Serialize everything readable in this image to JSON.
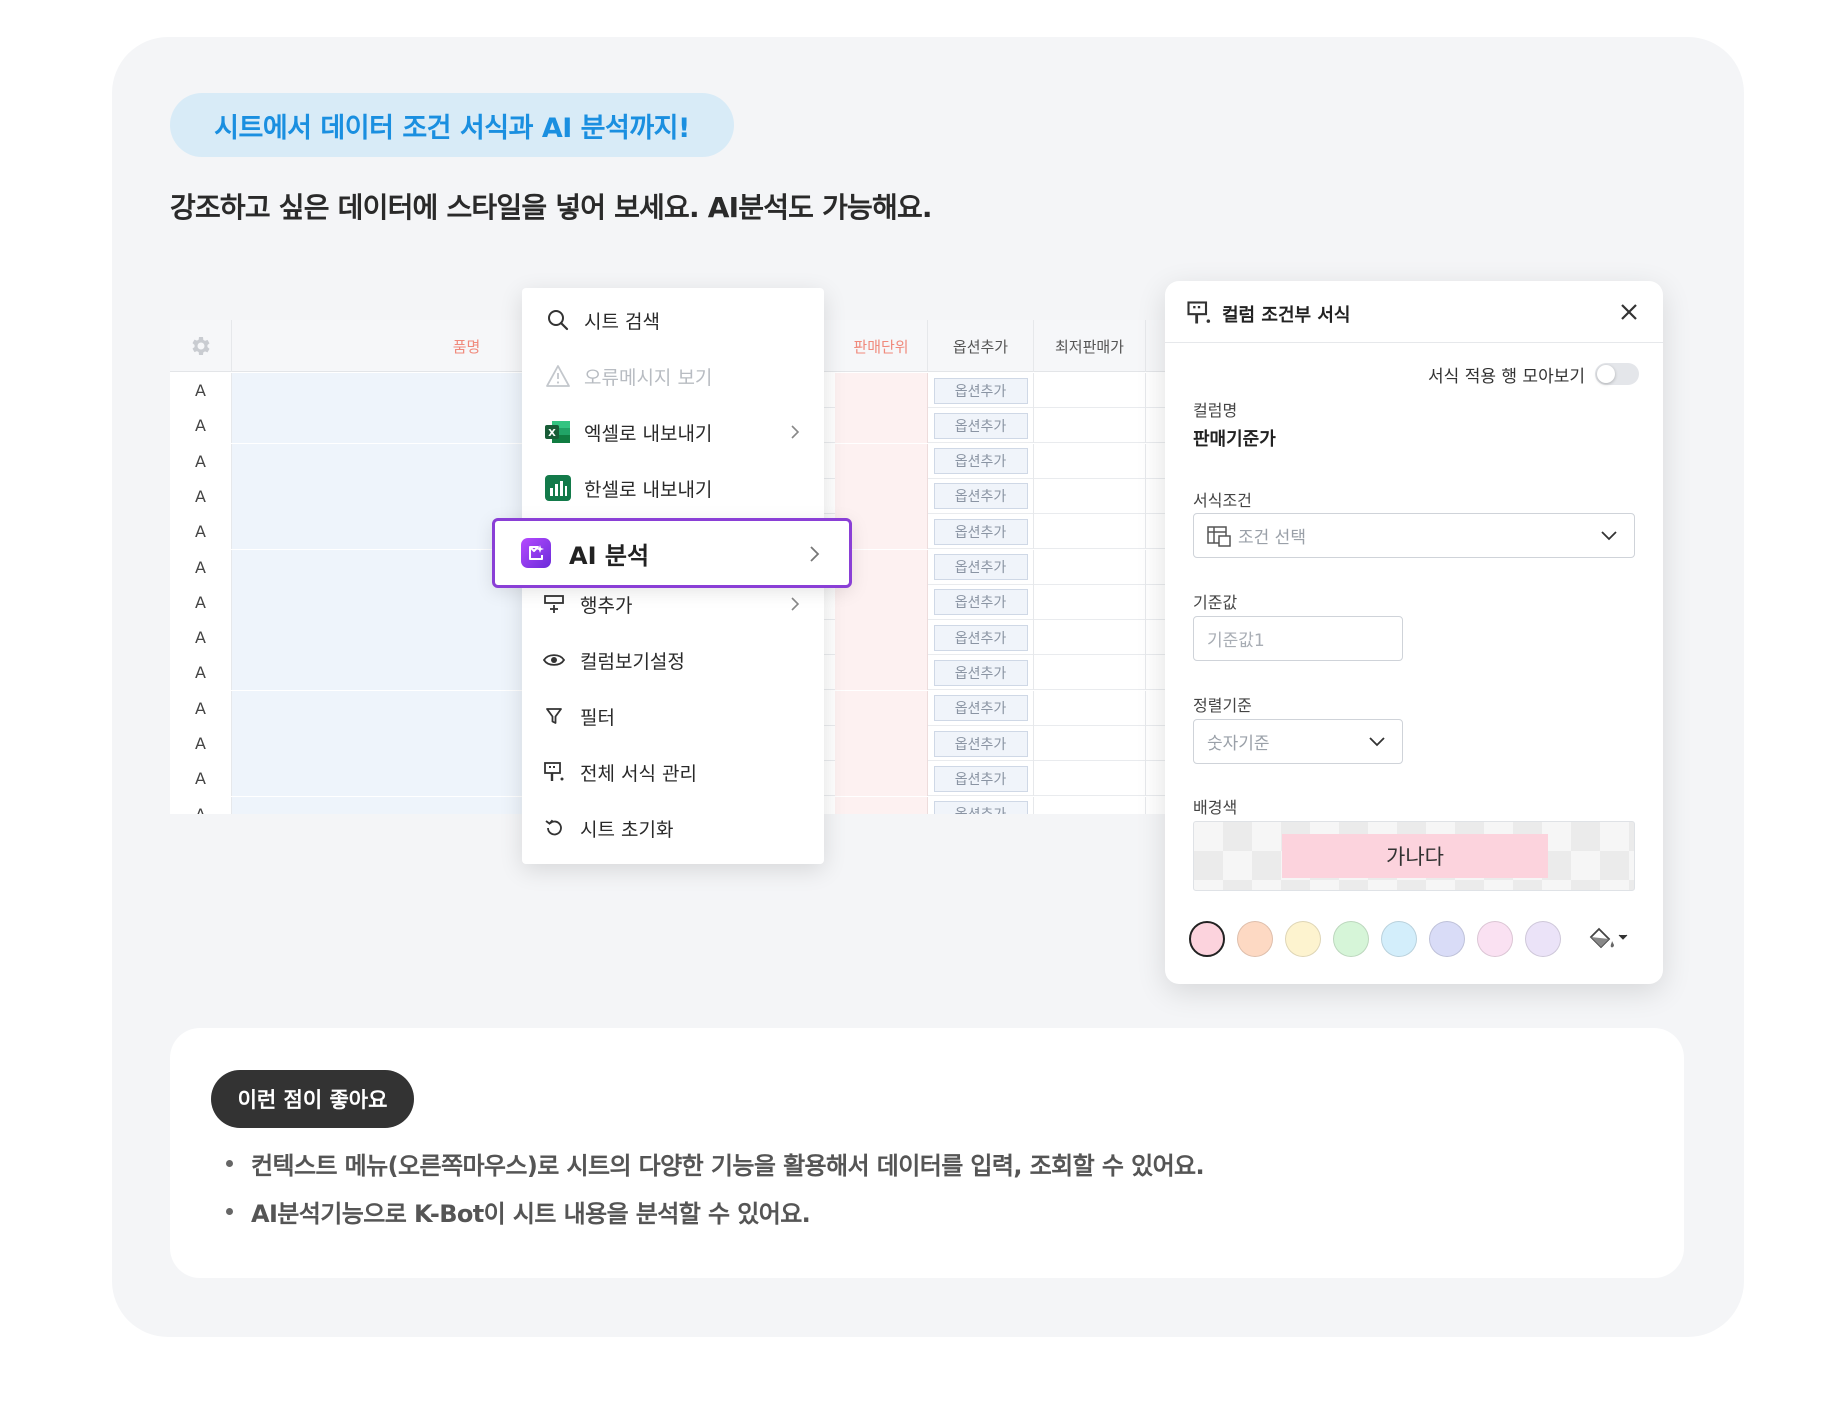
{
  "header": {
    "pill_title": "시트에서 데이터 조건 서식과 AI 분석까지!",
    "subtitle": "강조하고 싶은 데이터에 스타일을 넣어 보세요. AI분석도 가능해요."
  },
  "sheet": {
    "columns": [
      "품명",
      "판매단위",
      "옵션추가",
      "최저판매가"
    ],
    "row_label": "A",
    "option_button_label": "옵션추가",
    "row_count": 13
  },
  "context_menu": {
    "items": [
      {
        "label": "시트 검색",
        "icon": "search-icon"
      },
      {
        "label": "오류메시지 보기",
        "icon": "warning-icon",
        "disabled": true
      },
      {
        "label": "엑셀로 내보내기",
        "icon": "excel-icon",
        "submenu": true
      },
      {
        "label": "한셀로 내보내기",
        "icon": "hancell-icon"
      },
      {
        "label": "AI 분석",
        "icon": "ai-icon",
        "submenu": true,
        "highlighted": true
      },
      {
        "label": "행추가",
        "icon": "add-row-icon",
        "submenu": true
      },
      {
        "label": "컬럼보기설정",
        "icon": "eye-icon"
      },
      {
        "label": "필터",
        "icon": "filter-icon"
      },
      {
        "label": "전체 서식 관리",
        "icon": "format-paint-icon"
      },
      {
        "label": "시트 초기화",
        "icon": "reset-icon"
      }
    ]
  },
  "format_panel": {
    "title": "컬럼 조건부 서식",
    "toggle_label": "서식 적용 행 모아보기",
    "column_name_label": "컬럼명",
    "column_name_value": "판매기준가",
    "condition_label": "서식조건",
    "condition_placeholder": "조건 선택",
    "base_value_label": "기준값",
    "base_value_placeholder": "기준값1",
    "sort_label": "정렬기준",
    "sort_value": "숫자기준",
    "bg_color_label": "배경색",
    "preview_text": "가나다",
    "swatches": [
      "#fcd3dd",
      "#fdd9c3",
      "#fdf3cf",
      "#d6f5d8",
      "#d3eefb",
      "#d9dcf7",
      "#fae1f2",
      "#ebe3f8"
    ]
  },
  "benefits": {
    "badge": "이런 점이 좋아요",
    "bullets": [
      "컨텍스트 메뉴(오른쪽마우스)로 시트의 다양한 기능을 활용해서 데이터를 입력, 조회할 수 있어요.",
      "AI분석기능으로 K-Bot이 시트 내용을 분석할 수 있어요."
    ]
  },
  "colors": {
    "accent_blue": "#1a8fe0",
    "ai_purple": "#8a3fd6"
  }
}
